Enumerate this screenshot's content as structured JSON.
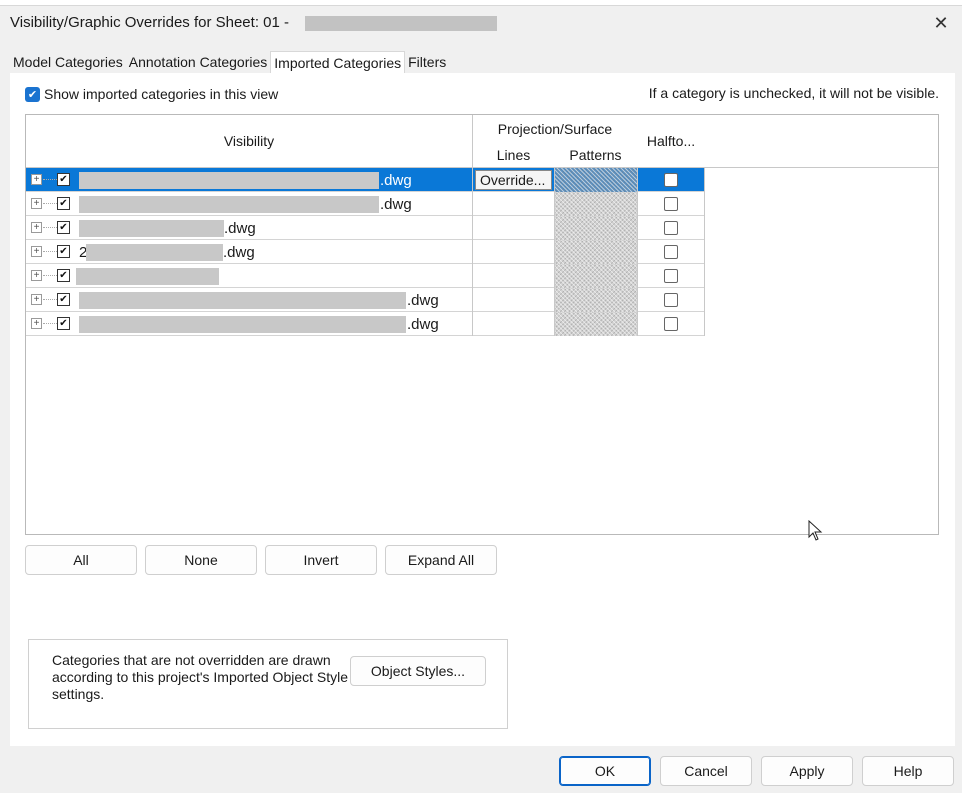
{
  "window": {
    "title": "Visibility/Graphic Overrides for Sheet: 01 -",
    "close_label": "✕"
  },
  "tabs": [
    {
      "label": "Model Categories",
      "active": false
    },
    {
      "label": "Annotation Categories",
      "active": false
    },
    {
      "label": "Imported Categories",
      "active": true
    },
    {
      "label": "Filters",
      "active": false
    }
  ],
  "options": {
    "show_imported_label": "Show imported categories in this view",
    "show_imported_checked": true,
    "note": "If a category is unchecked, it will not be visible."
  },
  "grid": {
    "headers": {
      "visibility": "Visibility",
      "projection_surface": "Projection/Surface",
      "lines": "Lines",
      "patterns": "Patterns",
      "halftone": "Halfto..."
    },
    "rows": [
      {
        "name_suffix": ".dwg",
        "checked": true,
        "selected": true,
        "lines": "Override...",
        "halftone": false
      },
      {
        "name_suffix": ".dwg",
        "checked": true,
        "selected": false,
        "lines": "",
        "halftone": false
      },
      {
        "name_suffix": ".dwg",
        "checked": true,
        "selected": false,
        "lines": "",
        "halftone": false
      },
      {
        "name_prefix": "2",
        "name_suffix": ".dwg",
        "checked": true,
        "selected": false,
        "lines": "",
        "halftone": false
      },
      {
        "name_suffix": "",
        "checked": true,
        "selected": false,
        "lines": "",
        "halftone": false
      },
      {
        "name_suffix": ".dwg",
        "checked": true,
        "selected": false,
        "lines": "",
        "halftone": false
      },
      {
        "name_suffix": ".dwg",
        "checked": true,
        "selected": false,
        "lines": "",
        "halftone": false
      }
    ]
  },
  "actions": {
    "all": "All",
    "none": "None",
    "invert": "Invert",
    "expand_all": "Expand All"
  },
  "info": {
    "text": "Categories that are not overridden are drawn according to this project's Imported Object Style settings.",
    "object_styles": "Object Styles..."
  },
  "footer": {
    "ok": "OK",
    "cancel": "Cancel",
    "apply": "Apply",
    "help": "Help"
  },
  "colors": {
    "selection": "#0a78d7",
    "checkbox_blue": "#1a73d0"
  }
}
